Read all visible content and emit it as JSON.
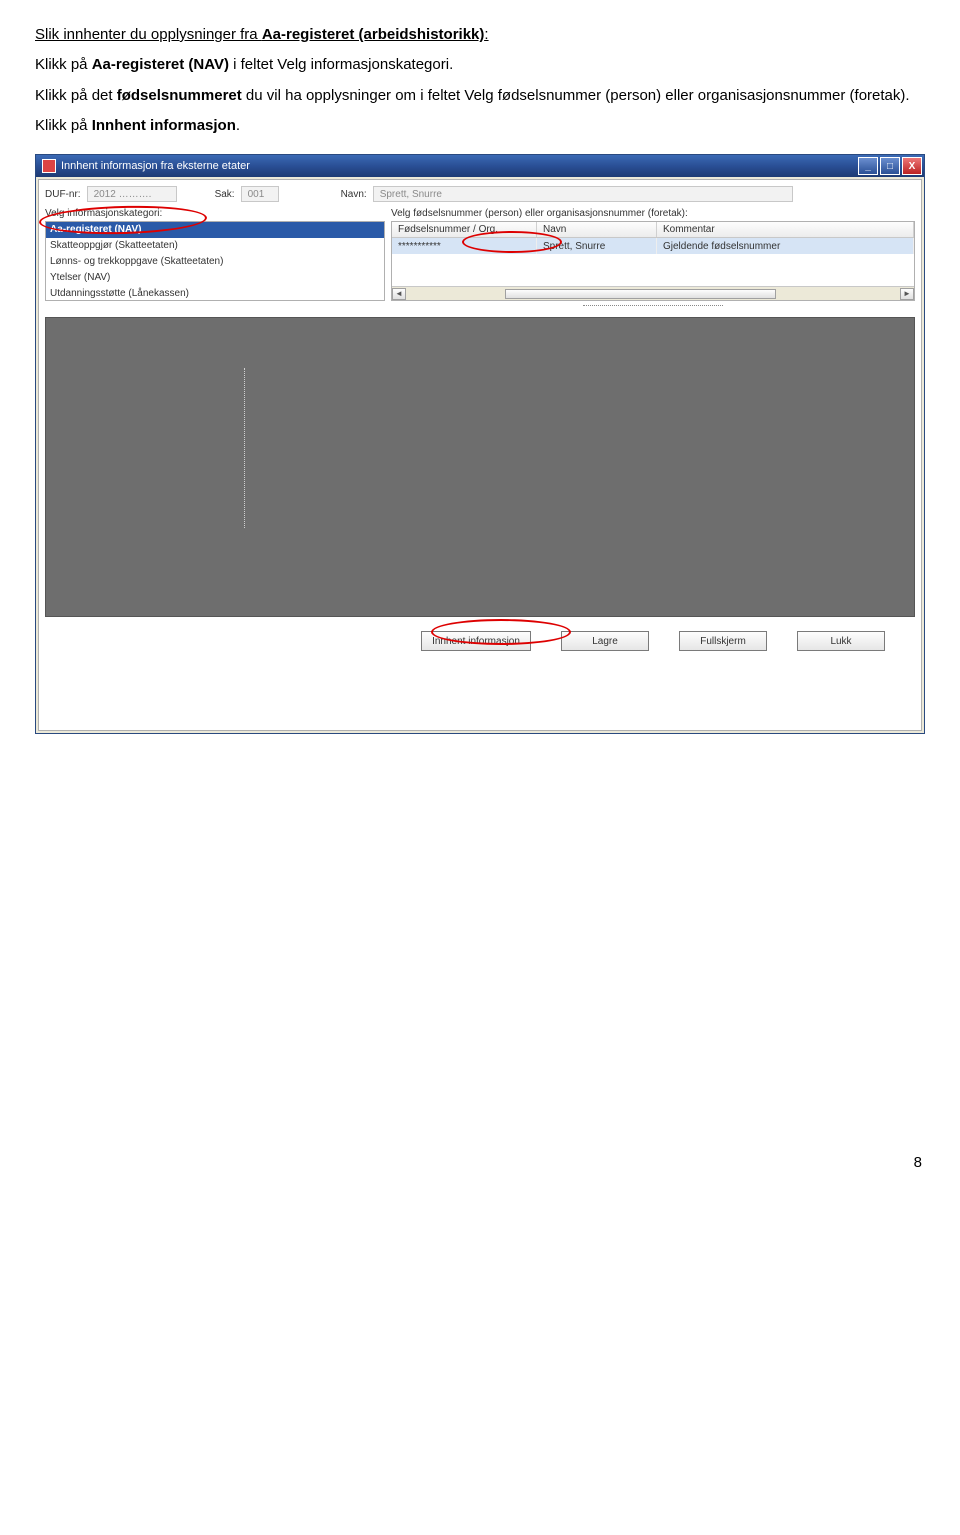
{
  "intro": {
    "title_plain": "Slik innhenter du opplysninger fra ",
    "title_bold": "Aa-registeret (arbeidshistorikk)",
    "title_tail": ":",
    "para1_a": "Klikk på ",
    "para1_b": "Aa-registeret (NAV)",
    "para1_c": " i feltet Velg informasjonskategori.",
    "para2_a": "Klikk på det ",
    "para2_b": "fødselsnummeret",
    "para2_c": " du vil ha opplysninger om i feltet Velg fødselsnummer (person) eller organisasjonsnummer (foretak).",
    "para3_a": "Klikk på ",
    "para3_b": "Innhent informasjon",
    "para3_c": "."
  },
  "window": {
    "title": "Innhent informasjon fra eksterne etater"
  },
  "header": {
    "duf_label": "DUF-nr:",
    "duf_value": "2012 ……….",
    "sak_label": "Sak:",
    "sak_value": "001",
    "navn_label": "Navn:",
    "navn_value": "Sprett, Snurre"
  },
  "left": {
    "label": "Velg informasjonskategori:",
    "items": [
      "Aa-registeret (NAV)",
      "Skatteoppgjør (Skatteetaten)",
      "Lønns- og trekkoppgave (Skatteetaten)",
      "Ytelser (NAV)",
      "Utdanningsstøtte (Lånekassen)"
    ]
  },
  "right": {
    "label": "Velg fødselsnummer (person) eller organisasjonsnummer (foretak):",
    "columns": [
      "Fødselsnummer / Org.",
      "Navn",
      "Kommentar"
    ],
    "row": {
      "fnr": "***********",
      "navn": "Sprett, Snurre",
      "kommentar": "Gjeldende fødselsnummer"
    }
  },
  "buttons": {
    "innhent": "Innhent informasjon",
    "lagre": "Lagre",
    "fullskjerm": "Fullskjerm",
    "lukk": "Lukk"
  },
  "winbtns": {
    "min": "_",
    "max": "□",
    "close": "X"
  },
  "scroll": {
    "left": "◄",
    "right": "►"
  },
  "page_number": "8"
}
